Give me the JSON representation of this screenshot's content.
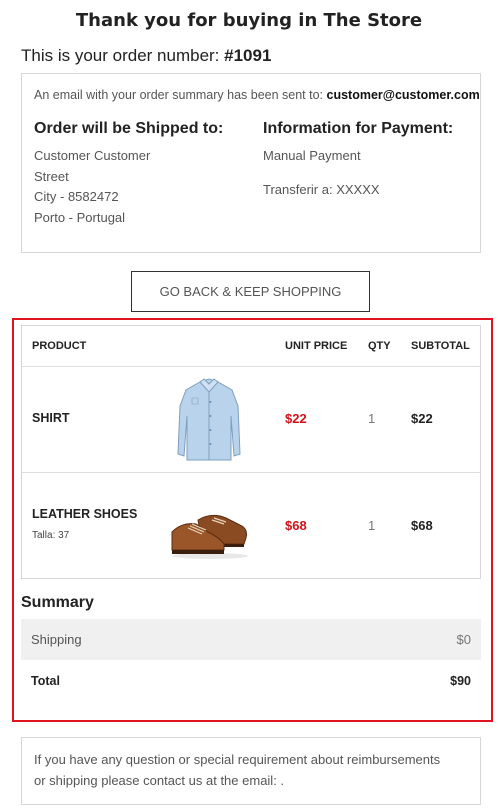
{
  "header": {
    "title": "Thank you for buying in The Store",
    "order_prefix": "This is your order number: ",
    "order_number": "#1091"
  },
  "info": {
    "email_prefix": "An email with your order summary has been sent to: ",
    "email": "customer@customer.com",
    "shipping": {
      "heading": "Order will be Shipped to:",
      "name": "Customer Customer",
      "street": "Street",
      "city": "City - 8582472",
      "region": "Porto - Portugal"
    },
    "payment": {
      "heading": "Information for Payment:",
      "method": "Manual Payment",
      "transfer": "Transferir a: XXXXX"
    }
  },
  "back_button": "GO BACK & KEEP SHOPPING",
  "table": {
    "headers": {
      "product": "PRODUCT",
      "unit_price": "UNIT PRICE",
      "qty": "QTY",
      "subtotal": "SUBTOTAL"
    },
    "rows": [
      {
        "name": "SHIRT",
        "variant": "",
        "unit_price": "$22",
        "qty": "1",
        "subtotal": "$22",
        "image": "shirt-image"
      },
      {
        "name": "LEATHER SHOES",
        "variant": "Talla: 37",
        "unit_price": "$68",
        "qty": "1",
        "subtotal": "$68",
        "image": "shoes-image"
      }
    ]
  },
  "summary": {
    "title": "Summary",
    "shipping_label": "Shipping",
    "shipping_value": "$0",
    "total_label": "Total",
    "total_value": "$90"
  },
  "contact": {
    "text": "If you have any question or special requirement about reimbursements or shipping please contact us at the email: ."
  },
  "colors": {
    "accent_red": "#d0121b",
    "frame_red": "#e0141e",
    "border": "#d6d6d6",
    "summary_bg": "#f0f0f0"
  }
}
